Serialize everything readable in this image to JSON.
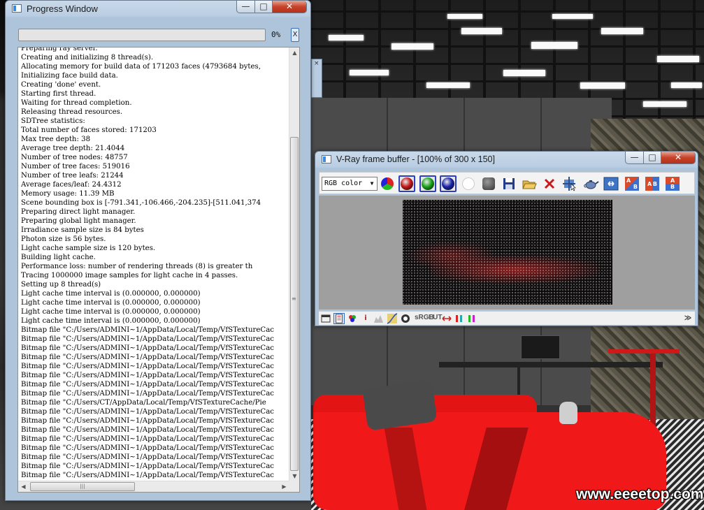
{
  "progress_window": {
    "title": "Progress Window",
    "minimize": "—",
    "maximize": "□",
    "close": "✕",
    "progress": 0,
    "progress_label": "0%",
    "cancel_label": "X",
    "log": [
      "Preparing ray server.",
      "Creating and initializing 8 thread(s).",
      "Allocating memory for build data of 171203 faces (4793684 bytes,",
      "Initializing face build data.",
      "Creating 'done' event.",
      "Starting first thread.",
      "Waiting for thread completion.",
      "Releasing thread resources.",
      "SDTree statistics:",
      "Total number of faces stored: 171203",
      "Max tree depth: 38",
      "Average tree depth: 21.4044",
      "Number of tree nodes: 48757",
      "Number of tree faces: 519016",
      "Number of tree leafs: 21244",
      "Average faces/leaf: 24.4312",
      "Memory usage: 11.39 MB",
      "Scene bounding box is [-791.341,-106.466,-204.235]-[511.041,374",
      "Preparing direct light manager.",
      "Preparing global light manager.",
      "Irradiance sample size is 84 bytes",
      "Photon size is 56 bytes.",
      "Light cache sample size is 120 bytes.",
      "Building light cache.",
      "Performance loss: number of rendering threads (8) is greater th",
      "Tracing 1000000 image samples for light cache in 4 passes.",
      "Setting up 8 thread(s)",
      "Light cache time interval is (0.000000, 0.000000)",
      "Light cache time interval is (0.000000, 0.000000)",
      "Light cache time interval is (0.000000, 0.000000)",
      "Light cache time interval is (0.000000, 0.000000)",
      "Bitmap file \"C:/Users/ADMINI~1/AppData/Local/Temp/VfSTextureCac",
      "Bitmap file \"C:/Users/ADMINI~1/AppData/Local/Temp/VfSTextureCac",
      "Bitmap file \"C:/Users/ADMINI~1/AppData/Local/Temp/VfSTextureCac",
      "Bitmap file \"C:/Users/ADMINI~1/AppData/Local/Temp/VfSTextureCac",
      "Bitmap file \"C:/Users/ADMINI~1/AppData/Local/Temp/VfSTextureCac",
      "Bitmap file \"C:/Users/ADMINI~1/AppData/Local/Temp/VfSTextureCac",
      "Bitmap file \"C:/Users/ADMINI~1/AppData/Local/Temp/VfSTextureCac",
      "Bitmap file \"C:/Users/ADMINI~1/AppData/Local/Temp/VfSTextureCac",
      "Bitmap file \"C:/Users/CT/AppData/Local/Temp/VfSTextureCache/Pie",
      "Bitmap file \"C:/Users/ADMINI~1/AppData/Local/Temp/VfSTextureCac",
      "Bitmap file \"C:/Users/ADMINI~1/AppData/Local/Temp/VfSTextureCac",
      "Bitmap file \"C:/Users/ADMINI~1/AppData/Local/Temp/VfSTextureCac",
      "Bitmap file \"C:/Users/ADMINI~1/AppData/Local/Temp/VfSTextureCac",
      "Bitmap file \"C:/Users/ADMINI~1/AppData/Local/Temp/VfSTextureCac",
      "Bitmap file \"C:/Users/ADMINI~1/AppData/Local/Temp/VfSTextureCac",
      "Bitmap file \"C:/Users/ADMINI~1/AppData/Local/Temp/VfSTextureCac",
      "Bitmap file \"C:/Users/ADMINI~1/AppData/Local/Temp/VfSTextureCac"
    ],
    "scroll_up": "▲",
    "scroll_down": "▼",
    "scroll_left": "◀",
    "scroll_right": "▶",
    "hthumb_grip": "|||",
    "vthumb_grip": "≡"
  },
  "mini_panel": {
    "close": "×"
  },
  "vray_window": {
    "title": "V-Ray frame buffer - [100% of 300 x 150]",
    "minimize": "—",
    "maximize": "□",
    "close": "✕",
    "channel": "RGB color",
    "channel_arrow": "▼",
    "colors": {
      "red": "#c21a1a",
      "green": "#1aa21a",
      "blue": "#1a24a8",
      "accent": "#2b3fbf"
    },
    "toolbar": [
      {
        "name": "rgb-channels-icon"
      },
      {
        "name": "red-channel-icon"
      },
      {
        "name": "green-channel-icon"
      },
      {
        "name": "blue-channel-icon"
      },
      {
        "name": "alpha-channel-icon"
      },
      {
        "name": "mono-channel-icon"
      },
      {
        "name": "save-icon"
      },
      {
        "name": "open-icon"
      },
      {
        "name": "clear-icon"
      },
      {
        "name": "track-mouse-icon"
      },
      {
        "name": "render-teapot-icon"
      },
      {
        "name": "region-render-icon"
      },
      {
        "name": "ab-compare-icon"
      },
      {
        "name": "ab-horizontal-icon"
      },
      {
        "name": "ab-vertical-icon"
      }
    ],
    "ab_letters": {
      "a": "A",
      "b": "B"
    },
    "bottom_labels": {
      "srgb": "sRGB",
      "lut": "LUT",
      "expand": "≫"
    }
  },
  "watermark": "www.eeeetop.com"
}
